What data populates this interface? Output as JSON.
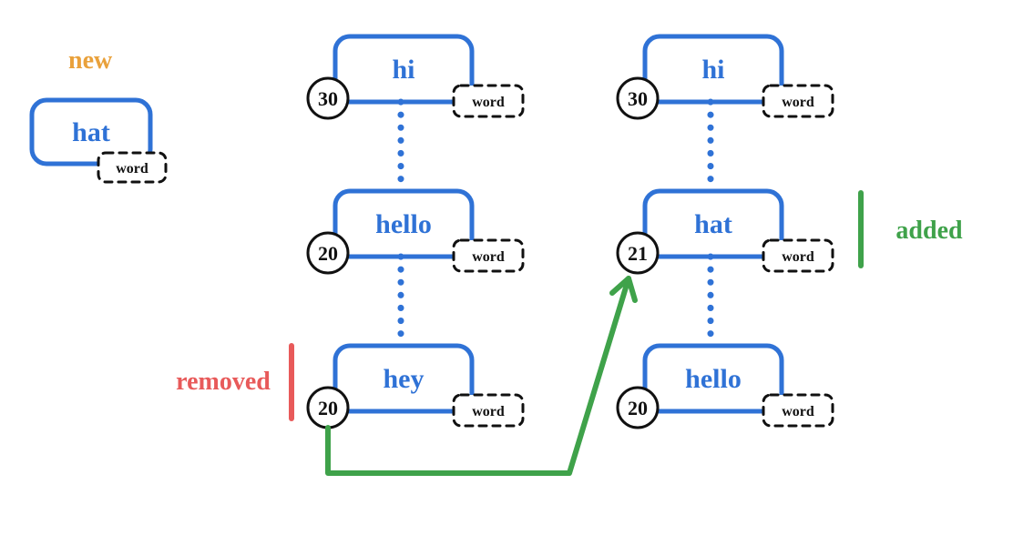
{
  "annotations": {
    "new": "new",
    "removed": "removed",
    "added": "added"
  },
  "new_node": {
    "label": "hat",
    "tag": "word"
  },
  "left_column": [
    {
      "label": "hi",
      "badge": "30",
      "tag": "word"
    },
    {
      "label": "hello",
      "badge": "20",
      "tag": "word"
    },
    {
      "label": "hey",
      "badge": "20",
      "tag": "word"
    }
  ],
  "right_column": [
    {
      "label": "hi",
      "badge": "30",
      "tag": "word"
    },
    {
      "label": "hat",
      "badge": "21",
      "tag": "word"
    },
    {
      "label": "hello",
      "badge": "20",
      "tag": "word"
    }
  ],
  "colors": {
    "blue": "#2f72d6",
    "orange": "#e9a13b",
    "red": "#e85a5a",
    "green": "#3fa24a",
    "black": "#111"
  },
  "chart_data": {
    "type": "diagram",
    "description": "Linked-list / priority-list update: a new node 'hat' is inserted; left list shows original [hi:30, hello:20, hey:20], right list shows result [hi:30, hat:21, hello:20]. 'hey' is removed, 'hat' is added.",
    "before": [
      {
        "word": "hi",
        "score": 30
      },
      {
        "word": "hello",
        "score": 20
      },
      {
        "word": "hey",
        "score": 20
      }
    ],
    "after": [
      {
        "word": "hi",
        "score": 30
      },
      {
        "word": "hat",
        "score": 21
      },
      {
        "word": "hello",
        "score": 20
      }
    ],
    "new_item": {
      "word": "hat"
    },
    "removed_item": {
      "word": "hey",
      "score": 20
    },
    "added_item": {
      "word": "hat",
      "score": 21
    }
  }
}
